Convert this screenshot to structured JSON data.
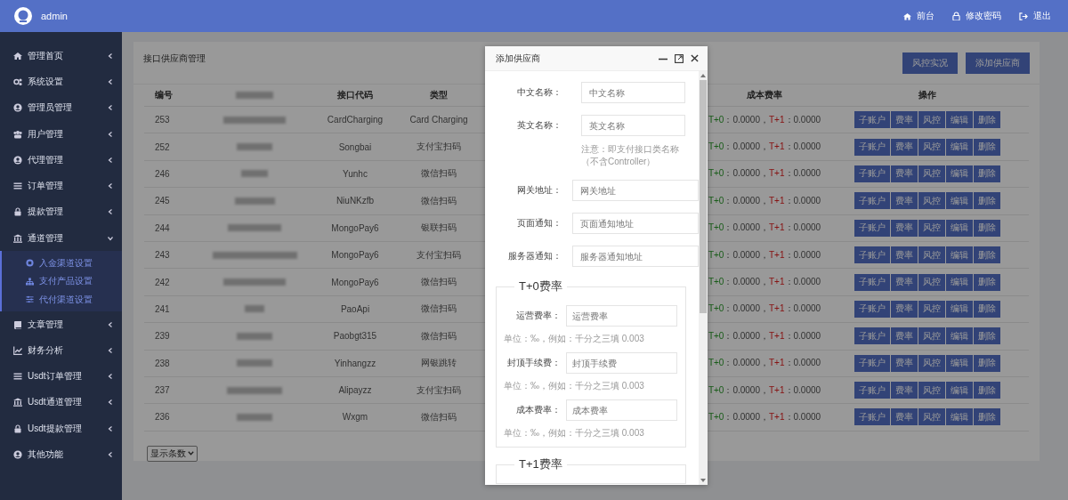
{
  "topbar": {
    "user": "admin",
    "links": [
      {
        "label": "前台"
      },
      {
        "label": "修改密码"
      },
      {
        "label": "退出"
      }
    ]
  },
  "sidebar": {
    "items": [
      {
        "label": "管理首页",
        "expanded": false
      },
      {
        "label": "系统设置",
        "expanded": false
      },
      {
        "label": "管理员管理",
        "expanded": false
      },
      {
        "label": "用户管理",
        "expanded": false
      },
      {
        "label": "代理管理",
        "expanded": false
      },
      {
        "label": "订单管理",
        "expanded": false
      },
      {
        "label": "提款管理",
        "expanded": false
      },
      {
        "label": "通道管理",
        "expanded": true,
        "children": [
          {
            "label": "入金渠道设置"
          },
          {
            "label": "支付产品设置"
          },
          {
            "label": "代付渠道设置"
          }
        ]
      },
      {
        "label": "文章管理",
        "expanded": false
      },
      {
        "label": "财务分析",
        "expanded": false
      },
      {
        "label": "Usdt订单管理",
        "expanded": false
      },
      {
        "label": "Usdt通道管理",
        "expanded": false
      },
      {
        "label": "Usdt提款管理",
        "expanded": false
      },
      {
        "label": "其他功能",
        "expanded": false
      }
    ]
  },
  "panel": {
    "title": "接口供应商管理",
    "buttons": [
      {
        "label": "风控实况"
      },
      {
        "label": "添加供应商"
      }
    ],
    "table": {
      "columns": {
        "id": "编号",
        "code": "接口代码",
        "type": "类型",
        "cost": "成本费率",
        "actions": "操作"
      },
      "rows": [
        {
          "id": "253",
          "code": "CardCharging",
          "type": "Card Charging",
          "cost": {
            "t0_label": "T+0",
            "t0_value": "：0.0000，",
            "t1_label": "T+1",
            "t1_value": "：0.0000"
          },
          "actions": [
            "子账户",
            "费率",
            "风控",
            "编辑",
            "删除"
          ]
        },
        {
          "id": "252",
          "code": "Songbai",
          "type": "支付宝扫码",
          "cost": {
            "t0_label": "T+0",
            "t0_value": "：0.0000，",
            "t1_label": "T+1",
            "t1_value": "：0.0000"
          },
          "actions": [
            "子账户",
            "费率",
            "风控",
            "编辑",
            "删除"
          ]
        },
        {
          "id": "246",
          "code": "Yunhc",
          "type": "微信扫码",
          "cost": {
            "t0_label": "T+0",
            "t0_value": "：0.0000，",
            "t1_label": "T+1",
            "t1_value": "：0.0000"
          },
          "actions": [
            "子账户",
            "费率",
            "风控",
            "编辑",
            "删除"
          ]
        },
        {
          "id": "245",
          "code": "NiuNKzfb",
          "type": "微信扫码",
          "cost": {
            "t0_label": "T+0",
            "t0_value": "：0.0000，",
            "t1_label": "T+1",
            "t1_value": "：0.0000"
          },
          "actions": [
            "子账户",
            "费率",
            "风控",
            "编辑",
            "删除"
          ]
        },
        {
          "id": "244",
          "code": "MongoPay6",
          "type": "银联扫码",
          "cost": {
            "t0_label": "T+0",
            "t0_value": "：0.0000，",
            "t1_label": "T+1",
            "t1_value": "：0.0000"
          },
          "actions": [
            "子账户",
            "费率",
            "风控",
            "编辑",
            "删除"
          ]
        },
        {
          "id": "243",
          "code": "MongoPay6",
          "type": "支付宝扫码",
          "cost": {
            "t0_label": "T+0",
            "t0_value": "：0.0000，",
            "t1_label": "T+1",
            "t1_value": "：0.0000"
          },
          "actions": [
            "子账户",
            "费率",
            "风控",
            "编辑",
            "删除"
          ]
        },
        {
          "id": "242",
          "code": "MongoPay6",
          "type": "微信扫码",
          "cost": {
            "t0_label": "T+0",
            "t0_value": "：0.0000，",
            "t1_label": "T+1",
            "t1_value": "：0.0000"
          },
          "actions": [
            "子账户",
            "费率",
            "风控",
            "编辑",
            "删除"
          ]
        },
        {
          "id": "241",
          "code": "PaoApi",
          "type": "微信扫码",
          "cost": {
            "t0_label": "T+0",
            "t0_value": "：0.0000，",
            "t1_label": "T+1",
            "t1_value": "：0.0000"
          },
          "actions": [
            "子账户",
            "费率",
            "风控",
            "编辑",
            "删除"
          ]
        },
        {
          "id": "239",
          "code": "Paobgt315",
          "type": "微信扫码",
          "cost": {
            "t0_label": "T+0",
            "t0_value": "：0.0000，",
            "t1_label": "T+1",
            "t1_value": "：0.0000"
          },
          "actions": [
            "子账户",
            "费率",
            "风控",
            "编辑",
            "删除"
          ]
        },
        {
          "id": "238",
          "code": "Yinhangzz",
          "type": "网银跳转",
          "cost": {
            "t0_label": "T+0",
            "t0_value": "：0.0000，",
            "t1_label": "T+1",
            "t1_value": "：0.0000"
          },
          "actions": [
            "子账户",
            "费率",
            "风控",
            "编辑",
            "删除"
          ]
        },
        {
          "id": "237",
          "code": "Alipayzz",
          "type": "支付宝扫码",
          "cost": {
            "t0_label": "T+0",
            "t0_value": "：0.0000，",
            "t1_label": "T+1",
            "t1_value": "：0.0000"
          },
          "actions": [
            "子账户",
            "费率",
            "风控",
            "编辑",
            "删除"
          ]
        },
        {
          "id": "236",
          "code": "Wxgm",
          "type": "微信扫码",
          "cost": {
            "t0_label": "T+0",
            "t0_value": "：0.0000，",
            "t1_label": "T+1",
            "t1_value": "：0.0000"
          },
          "actions": [
            "子账户",
            "费率",
            "风控",
            "编辑",
            "删除"
          ]
        }
      ]
    },
    "page_size": {
      "label": "显示条数"
    }
  },
  "dialog": {
    "title": "添加供应商",
    "fields": [
      {
        "label": "中文名称：",
        "placeholder": "中文名称"
      },
      {
        "label": "英文名称：",
        "placeholder": "英文名称",
        "note": "注意：即支付接口类名称（不含Controller）"
      },
      {
        "label": "网关地址：",
        "placeholder": "网关地址"
      },
      {
        "label": "页面通知：",
        "placeholder": "页面通知地址"
      },
      {
        "label": "服务器通知：",
        "placeholder": "服务器通知地址"
      }
    ],
    "sections": [
      {
        "legend": "T+0费率",
        "fields": [
          {
            "label": "运营费率：",
            "placeholder": "运营费率",
            "note": "单位：‰，例如：千分之三填 0.003"
          },
          {
            "label": "封顶手续费：",
            "placeholder": "封顶手续费",
            "note": "单位：‰，例如：千分之三填 0.003"
          },
          {
            "label": "成本费率：",
            "placeholder": "成本费率",
            "note": "单位：‰，例如：千分之三填 0.003"
          }
        ]
      },
      {
        "legend": "T+1费率"
      }
    ]
  }
}
